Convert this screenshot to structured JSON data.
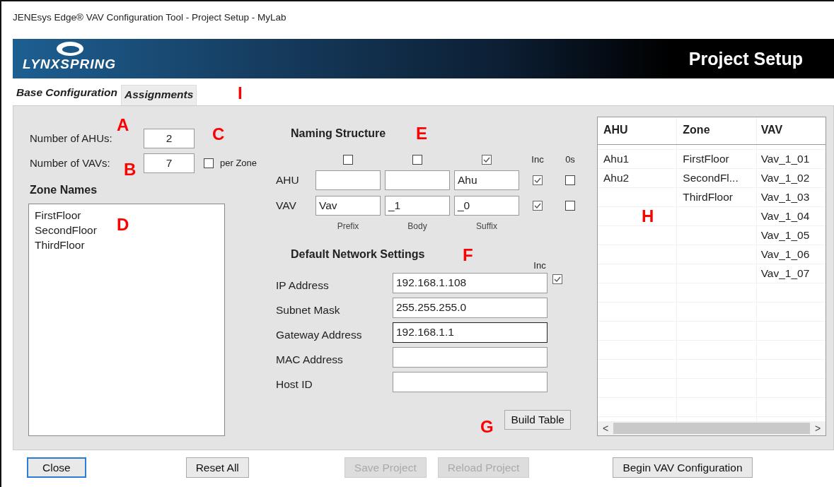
{
  "window": {
    "title": "JENEsys Edge® VAV Configuration Tool - Project Setup - MyLab"
  },
  "banner": {
    "logo": "LYNXSPRING",
    "title": "Project Setup"
  },
  "tabs": [
    {
      "label": "Base Configuration",
      "selected": true
    },
    {
      "label": "Assignments",
      "selected": false
    }
  ],
  "counts": [
    {
      "label": "Number of AHUs:",
      "value": "2"
    },
    {
      "label": "Number of VAVs:",
      "value": "7",
      "option": {
        "label": "per Zone",
        "checked": false
      }
    }
  ],
  "zone_names": {
    "title": "Zone Names",
    "items": [
      "FirstFloor",
      "SecondFloor",
      "ThirdFloor"
    ]
  },
  "naming": {
    "title": "Naming Structure",
    "column_checks": [
      false,
      false,
      true
    ],
    "inc_label": "Inc",
    "zeros_label": "0s",
    "rows": [
      {
        "label": "AHU",
        "suffix": "Ahu",
        "inc": true,
        "zeros": false
      },
      {
        "label": "VAV",
        "prefix": "Vav",
        "body": "_1",
        "suffix": "_0",
        "inc": true,
        "zeros": false
      }
    ],
    "column_labels": [
      "Prefix",
      "Body",
      "Suffix"
    ]
  },
  "network": {
    "title": "Default Network Settings",
    "inc_label": "Inc",
    "rows": [
      {
        "label": "IP Address",
        "value": "192.168.1.108",
        "focused": false,
        "inc": true
      },
      {
        "label": "Subnet Mask",
        "value": "255.255.255.0",
        "focused": false
      },
      {
        "label": "Gateway Address",
        "value": "192.168.1.1",
        "focused": true
      },
      {
        "label": "MAC Address",
        "focused": false
      },
      {
        "label": "Host ID",
        "focused": false
      }
    ]
  },
  "build_button": "Build Table",
  "table": {
    "columns": [
      "AHU",
      "Zone",
      "VAV"
    ],
    "rows": [
      [
        "Ahu1",
        "FirstFloor",
        "Vav_1_01"
      ],
      [
        "Ahu2",
        "SecondFl...",
        "Vav_1_02"
      ],
      [
        null,
        "ThirdFloor",
        "Vav_1_03"
      ],
      [
        null,
        null,
        "Vav_1_04"
      ],
      [
        null,
        null,
        "Vav_1_05"
      ],
      [
        null,
        null,
        "Vav_1_06"
      ],
      [
        null,
        null,
        "Vav_1_07"
      ]
    ],
    "scroll_left": "<",
    "scroll_right": ">"
  },
  "buttons": [
    {
      "label": "Close",
      "disabled": false,
      "focused": true
    },
    {
      "label": "Reset All",
      "disabled": false,
      "focused": false
    },
    {
      "label": "Save Project",
      "disabled": true,
      "focused": false
    },
    {
      "label": "Reload Project",
      "disabled": true,
      "focused": false
    },
    {
      "label": "Begin VAV Configuration",
      "disabled": false,
      "focused": false
    }
  ],
  "callouts": [
    "A",
    "B",
    "C",
    "D",
    "E",
    "F",
    "G",
    "H",
    "I"
  ]
}
